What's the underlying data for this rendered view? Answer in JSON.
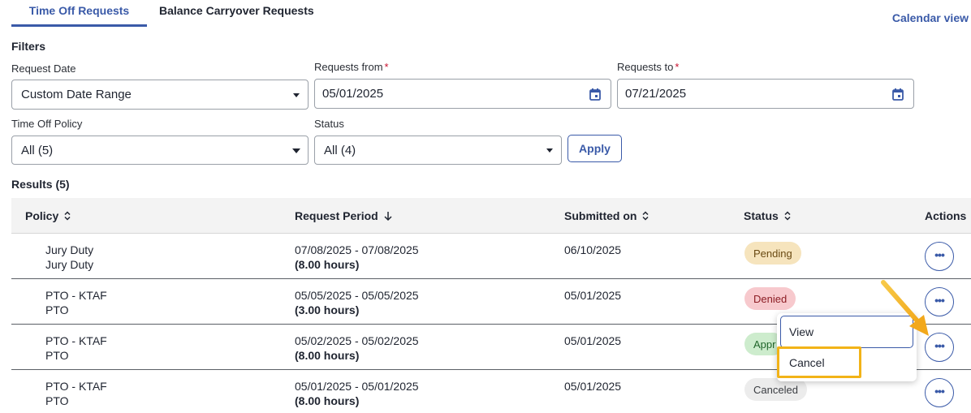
{
  "tabs": {
    "active_label": "Time Off Requests",
    "inactive_label": "Balance Carryover Requests"
  },
  "calendar_view_label": "Calendar view",
  "filters": {
    "title": "Filters",
    "request_date": {
      "label": "Request Date",
      "value": "Custom Date Range"
    },
    "requests_from": {
      "label": "Requests from",
      "required_mark": "*",
      "value": "05/01/2025"
    },
    "requests_to": {
      "label": "Requests to",
      "required_mark": "*",
      "value": "07/21/2025"
    },
    "time_off_policy": {
      "label": "Time Off Policy",
      "value": "All (5)"
    },
    "status": {
      "label": "Status",
      "value": "All (4)"
    },
    "apply_label": "Apply"
  },
  "results": {
    "title": "Results (5)",
    "columns": {
      "policy": "Policy",
      "request_period": "Request Period",
      "submitted_on": "Submitted on",
      "status": "Status",
      "actions": "Actions"
    },
    "rows": [
      {
        "policy_line1": "Jury Duty",
        "policy_line2": "Jury Duty",
        "period": "07/08/2025 - 07/08/2025",
        "hours": "(8.00 hours)",
        "submitted": "06/10/2025",
        "status": "Pending"
      },
      {
        "policy_line1": "PTO - KTAF",
        "policy_line2": "PTO",
        "period": "05/05/2025 - 05/05/2025",
        "hours": "(3.00 hours)",
        "submitted": "05/01/2025",
        "status": "Denied"
      },
      {
        "policy_line1": "PTO - KTAF",
        "policy_line2": "PTO",
        "period": "05/02/2025 - 05/02/2025",
        "hours": "(8.00 hours)",
        "submitted": "05/01/2025",
        "status": "Appr"
      },
      {
        "policy_line1": "PTO - KTAF",
        "policy_line2": "PTO",
        "period": "05/01/2025 - 05/01/2025",
        "hours": "(8.00 hours)",
        "submitted": "05/01/2025",
        "status": "Canceled"
      }
    ],
    "more_actions_glyph": "•••"
  },
  "action_menu": {
    "view_label": "View",
    "cancel_label": "Cancel"
  },
  "colors": {
    "accent": "#3a5aa8",
    "highlight": "#f2b318",
    "required": "#c8102e"
  }
}
